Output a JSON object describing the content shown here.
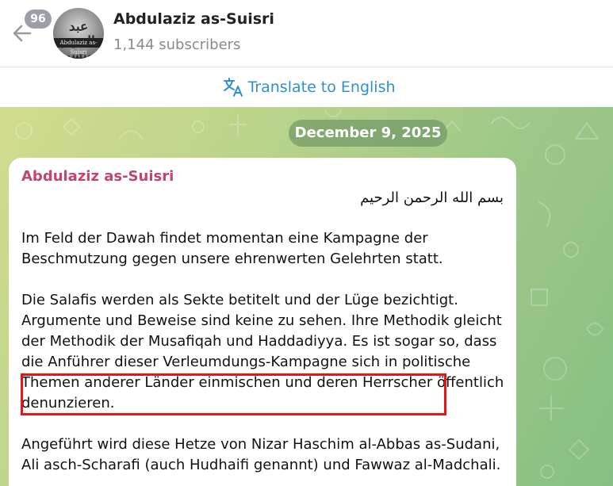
{
  "header": {
    "unread_count": "96",
    "channel_title": "Abdulaziz as-Suisri",
    "subscribers": "1,144 subscribers",
    "avatar": {
      "script": "عبد العزيز السويسري",
      "band": "Abdulaziz as-Suisri"
    }
  },
  "translate": {
    "label": "Translate to English"
  },
  "chat": {
    "date": "December 9, 2025",
    "message": {
      "sender": "Abdulaziz as-Suisri",
      "basmala": "بسم الله الرحمن الرحيم",
      "p1": "Im Feld der Dawah findet momentan eine Kampagne der Beschmutzung gegen unsere ehrenwerten Gelehrten statt.",
      "p2": "Die Salafis werden als Sekte betitelt und der Lüge bezichtigt. Argumente und Beweise sind keine zu sehen. Ihre Methodik gleicht der Methodik der Musafiqah und Haddadiyya. Es ist sogar so, dass die Anführer dieser Verleumdungs-Kampagne sich in politische Themen anderer Länder einmischen und deren Herrscher öffentlich denunzieren.",
      "p3": "Angeführt wird diese Hetze von Nizar Haschim al-Abbas as-Sudani, Ali asch-Scharafi (auch Hudhaifi genannt) und Fawwaz al-Madchali."
    }
  },
  "colors": {
    "accent_blue": "#2f8fd4",
    "sender_pink": "#c2456b",
    "highlight_red": "#e8141a",
    "badge_gray": "#9aa0a6"
  },
  "icons": {
    "back": "arrow-left-icon",
    "translate": "translate-icon"
  }
}
